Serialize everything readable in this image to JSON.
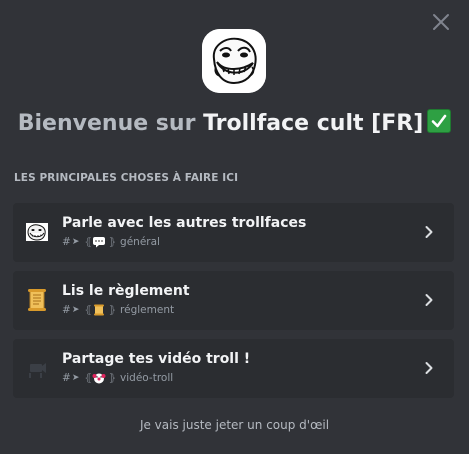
{
  "dialog": {
    "title_prefix": "Bienvenue sur ",
    "server_name": "Trollface cult [FR]",
    "title_emoji": "white-check-mark-emoji",
    "section_header": "LES PRINCIPALES CHOSES À FAIRE ICI",
    "skip_label": "Je vais juste jeter un coup d'œil"
  },
  "todos": [
    {
      "title": "Parle avec les autres trollfaces",
      "hash": "#",
      "channel_name": "général",
      "icon": "trollface-icon",
      "channel_emoji": "speech-bubble-emoji"
    },
    {
      "title": "Lis le règlement",
      "hash": "#",
      "channel_name": "réglement",
      "icon": "scroll-icon",
      "channel_emoji": "scroll-emoji"
    },
    {
      "title": "Partage tes vidéo troll !",
      "hash": "#",
      "channel_name": "vidéo-troll",
      "icon": "movie-camera-icon",
      "channel_emoji": "clown-emoji"
    }
  ],
  "colors": {
    "background": "#313338",
    "card": "#2b2d31",
    "text_primary": "#f2f3f5",
    "text_muted": "#b5bac1",
    "text_channel": "#949ba4"
  }
}
